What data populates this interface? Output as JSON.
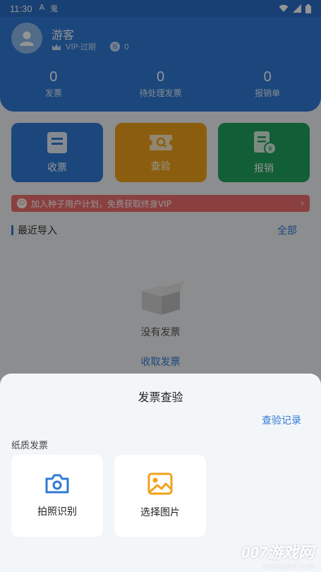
{
  "status_bar": {
    "time": "11:30",
    "left_icons": [
      "A",
      "鬼"
    ]
  },
  "header": {
    "username": "游客",
    "vip_status": "VIP·过期",
    "coin_icon_text": "币",
    "coins": "0",
    "stats": [
      {
        "value": "0",
        "label": "发票"
      },
      {
        "value": "0",
        "label": "待处理发票"
      },
      {
        "value": "0",
        "label": "报销单"
      }
    ]
  },
  "actions": [
    {
      "label": "收票",
      "color": "#2f7ad6"
    },
    {
      "label": "查验",
      "color": "#f0a21b"
    },
    {
      "label": "报销",
      "color": "#1fa25d"
    }
  ],
  "banner": {
    "text": "加入种子用户计划，免费获取终身VIP"
  },
  "recent": {
    "title": "最近导入",
    "all_link": "全部",
    "empty_text": "没有发票",
    "collect_link": "收取发票"
  },
  "sheet": {
    "title": "发票查验",
    "history_link": "查验记录",
    "section_label": "纸质发票",
    "options": [
      {
        "label": "拍照识别",
        "icon": "camera-icon",
        "color": "#2f7ad6"
      },
      {
        "label": "选择图片",
        "icon": "image-icon",
        "color": "#f0a21b"
      }
    ]
  },
  "watermark": {
    "line1": "007游戏网",
    "line2": "www.yx007.com"
  }
}
